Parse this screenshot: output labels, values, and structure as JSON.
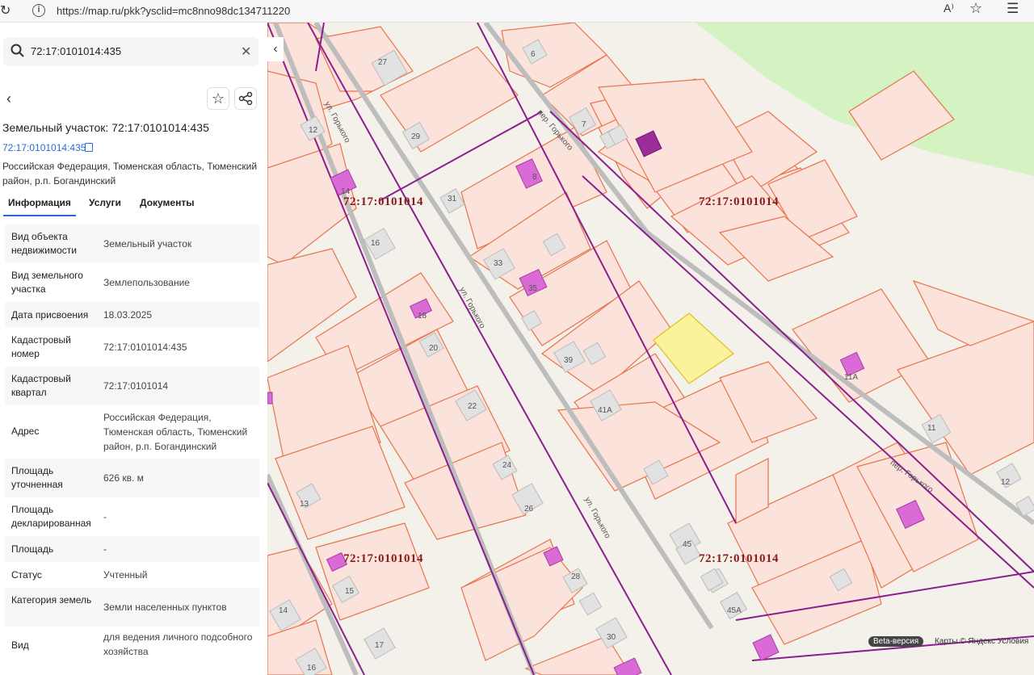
{
  "browser": {
    "url": "https://map.ru/pkk?ysclid=mc8nno98dc134711220"
  },
  "search": {
    "value": "72:17:0101014:435"
  },
  "card": {
    "title": "Земельный участок: 72:17:0101014:435",
    "cad_link": "72:17:0101014:435",
    "address_short": "Российская Федерация, Тюменская область, Тюменский район, р.п. Богандинский"
  },
  "tabs": [
    "Информация",
    "Услуги",
    "Документы"
  ],
  "properties": [
    {
      "key": "Вид объекта недвижимости",
      "value": "Земельный участок"
    },
    {
      "key": "Вид земельного участка",
      "value": "Землепользование"
    },
    {
      "key": "Дата присвоения",
      "value": "18.03.2025"
    },
    {
      "key": "Кадастровый номер",
      "value": "72:17:0101014:435"
    },
    {
      "key": "Кадастровый квартал",
      "value": "72:17:0101014"
    },
    {
      "key": "Адрес",
      "value": "Российская Федерация, Тюменская область, Тюменский район, р.п. Богандинский"
    },
    {
      "key": "Площадь уточненная",
      "value": "626 кв. м"
    },
    {
      "key": "Площадь декларированная",
      "value": "-"
    },
    {
      "key": "Площадь",
      "value": "-"
    },
    {
      "key": "Статус",
      "value": "Учтенный"
    },
    {
      "key": "Категория земель",
      "value": "Земли населенных пунктов"
    },
    {
      "key": "Вид",
      "value": "для ведения личного подсобного хозяйства"
    }
  ],
  "map": {
    "quarter_label": "72:17:0101014",
    "streets": {
      "gorkogo": "ул. Горького",
      "per_gorkogo": "пер. Горького"
    },
    "house_numbers": [
      "27",
      "6",
      "12",
      "29",
      "7",
      "8",
      "14",
      "31",
      "16",
      "33",
      "35",
      "18",
      "20",
      "39",
      "41А",
      "22",
      "24",
      "11А",
      "11",
      "13",
      "26",
      "12",
      "45",
      "28",
      "15",
      "14",
      "45А",
      "17",
      "30",
      "16"
    ],
    "beta": "Beta-версия",
    "copyright": "Карты © Яндекс   Условия"
  },
  "colors": {
    "parcel_fill": "#fbe3dc",
    "parcel_stroke": "#e8734a",
    "selected_fill": "#fbf39b",
    "boundary": "#8a1f8e",
    "building_violet": "#d96ad6",
    "green_area": "#d4f2c2",
    "link": "#2a6ad8"
  }
}
